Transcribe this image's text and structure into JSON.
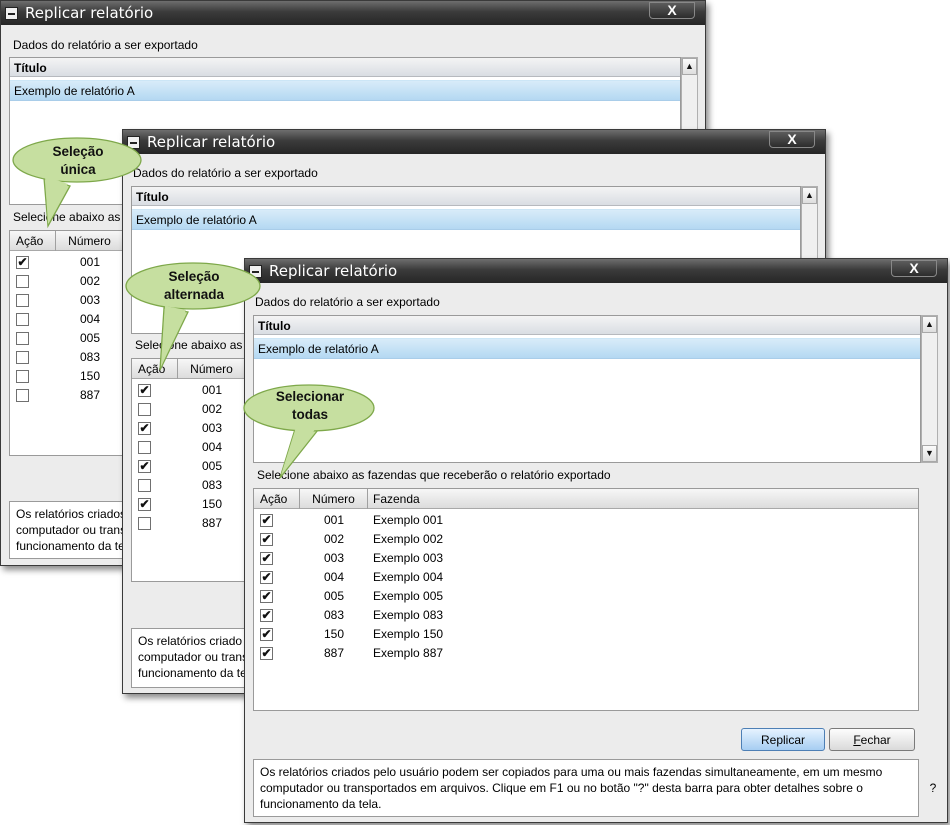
{
  "windows": [
    {
      "title": "Replicar relatório",
      "close_label": "X",
      "section_label": "Dados do relatório a ser exportado",
      "report_list_header": "Título",
      "report_item": "Exemplo de relatório A",
      "select_label": "Selecione abaixo as",
      "columns": [
        "Ação",
        "Número"
      ],
      "rows": [
        {
          "checked": "✔",
          "numero": "001"
        },
        {
          "checked": "",
          "numero": "002"
        },
        {
          "checked": "",
          "numero": "003"
        },
        {
          "checked": "",
          "numero": "004"
        },
        {
          "checked": "",
          "numero": "005"
        },
        {
          "checked": "",
          "numero": "083"
        },
        {
          "checked": "",
          "numero": "150"
        },
        {
          "checked": "",
          "numero": "887"
        }
      ],
      "info_lines": [
        "Os relatórios criados",
        "computador ou trans",
        "funcionamento da tela"
      ]
    },
    {
      "title": "Replicar relatório",
      "close_label": "X",
      "section_label": "Dados do relatório a ser exportado",
      "report_list_header": "Título",
      "report_item": "Exemplo de relatório A",
      "select_label": "Selecione abaixo as",
      "columns": [
        "Ação",
        "Número"
      ],
      "rows": [
        {
          "checked": "✔",
          "numero": "001"
        },
        {
          "checked": "",
          "numero": "002"
        },
        {
          "checked": "✔",
          "numero": "003"
        },
        {
          "checked": "",
          "numero": "004"
        },
        {
          "checked": "✔",
          "numero": "005"
        },
        {
          "checked": "",
          "numero": "083"
        },
        {
          "checked": "✔",
          "numero": "150"
        },
        {
          "checked": "",
          "numero": "887"
        }
      ],
      "info_lines": [
        "Os relatórios criado",
        "computador ou trans",
        "funcionamento da te"
      ]
    },
    {
      "title": "Replicar relatório",
      "close_label": "X",
      "section_label": "Dados do relatório a ser exportado",
      "report_list_header": "Título",
      "report_item": "Exemplo de relatório A",
      "select_label": "Selecione abaixo as fazendas que receberão o relatório exportado",
      "columns": [
        "Ação",
        "Número",
        "Fazenda"
      ],
      "rows": [
        {
          "checked": "✔",
          "numero": "001",
          "fazenda": "Exemplo 001"
        },
        {
          "checked": "✔",
          "numero": "002",
          "fazenda": "Exemplo 002"
        },
        {
          "checked": "✔",
          "numero": "003",
          "fazenda": "Exemplo 003"
        },
        {
          "checked": "✔",
          "numero": "004",
          "fazenda": "Exemplo 004"
        },
        {
          "checked": "✔",
          "numero": "005",
          "fazenda": "Exemplo 005"
        },
        {
          "checked": "✔",
          "numero": "083",
          "fazenda": "Exemplo 083"
        },
        {
          "checked": "✔",
          "numero": "150",
          "fazenda": "Exemplo 150"
        },
        {
          "checked": "✔",
          "numero": "887",
          "fazenda": "Exemplo 887"
        }
      ],
      "buttons": {
        "replicar": "Replicar",
        "fechar_underlined": "F",
        "fechar_rest": "echar"
      },
      "info_lines": [
        "Os relatórios criados pelo usuário podem ser copiados para uma ou mais fazendas simultaneamente, em um mesmo",
        "computador ou transportados em arquivos. Clique em F1 ou no botão \"?\" desta barra para obter detalhes sobre o",
        "funcionamento da tela."
      ],
      "help_label": "?"
    }
  ],
  "callouts": [
    {
      "lines": [
        "Seleção",
        "única"
      ]
    },
    {
      "lines": [
        "Seleção",
        "alternada"
      ]
    },
    {
      "lines": [
        "Selecionar",
        "todas"
      ]
    }
  ],
  "colors": {
    "callout_fill": "#c6dfa0",
    "callout_stroke": "#7ea84a",
    "selection": "#b4d8f2",
    "titlebar": "#2f2f2f"
  }
}
